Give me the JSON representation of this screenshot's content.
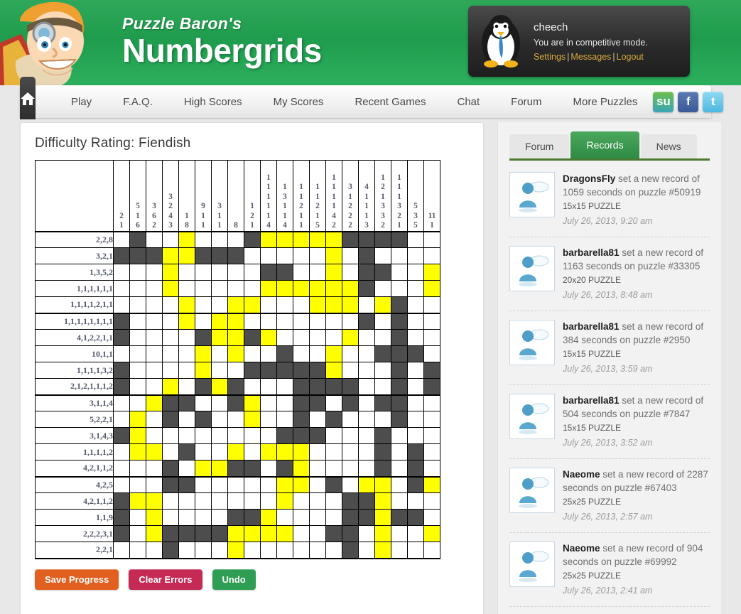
{
  "header": {
    "brand_top": "Puzzle Baron's",
    "brand_main": "Numbergrids",
    "user": {
      "name": "cheech",
      "mode": "You are in competitive mode.",
      "settings": "Settings",
      "messages": "Messages",
      "logout": "Logout",
      "sep": "|"
    }
  },
  "nav": {
    "home_icon": "home-icon",
    "items": [
      "Play",
      "F.A.Q.",
      "High Scores",
      "My Scores",
      "Recent Games",
      "Chat",
      "Forum",
      "More Puzzles"
    ],
    "socials": [
      {
        "name": "stumbleupon-icon",
        "glyph": "su",
        "color": "#6cbf4a"
      },
      {
        "name": "facebook-icon",
        "glyph": "f",
        "color": "#3b5998"
      },
      {
        "name": "twitter-icon",
        "glyph": "t",
        "color": "#4db8e0"
      }
    ]
  },
  "puzzle": {
    "difficulty_label": "Difficulty Rating: Fiendish",
    "size": 20,
    "colors": {
      "filled": "#4d4d4d",
      "marked": "#ffff00",
      "empty": "#ffffff",
      "clue_text": "#54596b"
    },
    "col_clues": [
      [
        "2",
        "1"
      ],
      [
        "5",
        "1",
        "6"
      ],
      [
        "3",
        "6",
        "2"
      ],
      [
        "3",
        "2",
        "4",
        "3"
      ],
      [
        "1",
        "8"
      ],
      [
        "9",
        "1",
        "1"
      ],
      [
        "3",
        "1",
        "1"
      ],
      [
        "8"
      ],
      [
        "1",
        "2",
        "1"
      ],
      [
        "1",
        "1",
        "1",
        "1",
        "1",
        "4"
      ],
      [
        "1",
        "3",
        "1",
        "1",
        "4"
      ],
      [
        "1",
        "1",
        "2",
        "1",
        "1"
      ],
      [
        "1",
        "1",
        "2",
        "1",
        "5"
      ],
      [
        "1",
        "1",
        "1",
        "1",
        "4",
        "2"
      ],
      [
        "3",
        "1",
        "2",
        "2",
        "2"
      ],
      [
        "4",
        "1",
        "1",
        "1",
        "3"
      ],
      [
        "1",
        "2",
        "1",
        "3",
        "3",
        "2"
      ],
      [
        "1",
        "1",
        "1",
        "3",
        "2",
        "1"
      ],
      [
        "5",
        "3",
        "5"
      ],
      [
        "11",
        "1"
      ]
    ],
    "row_clues": [
      "2,2,8",
      "3,2,1",
      "1,3,5,2",
      "1,1,1,1,1,1",
      "1,1,1,1,2,1,1",
      "1,1,1,1,1,1,1,1",
      "4,1,2,2,1,1",
      "10,1,1",
      "1,1,1,1,3,2",
      "2,1,2,1,1,1,2",
      "3,1,1,4",
      "5,2,2,1",
      "3,1,4,3",
      "1,1,1,1,2",
      "4,2,1,1,2",
      "4,2,5",
      "4,2,1,1,2",
      "1,1,9",
      "2,2,2,3,1",
      "2,2,1"
    ],
    "cells": [
      [
        "e",
        "f",
        "e",
        "e",
        "y",
        "e",
        "e",
        "e",
        "f",
        "y",
        "y",
        "y",
        "y",
        "y",
        "f",
        "f",
        "f",
        "f",
        "e",
        "e"
      ],
      [
        "f",
        "f",
        "f",
        "y",
        "y",
        "f",
        "f",
        "f",
        "e",
        "e",
        "e",
        "e",
        "e",
        "y",
        "e",
        "f",
        "e",
        "e",
        "e",
        "e"
      ],
      [
        "e",
        "e",
        "e",
        "y",
        "e",
        "e",
        "e",
        "e",
        "e",
        "f",
        "f",
        "e",
        "e",
        "y",
        "e",
        "f",
        "f",
        "e",
        "e",
        "y"
      ],
      [
        "e",
        "e",
        "e",
        "y",
        "e",
        "e",
        "e",
        "e",
        "e",
        "y",
        "y",
        "y",
        "y",
        "y",
        "y",
        "f",
        "e",
        "e",
        "e",
        "y"
      ],
      [
        "e",
        "e",
        "e",
        "e",
        "y",
        "e",
        "e",
        "y",
        "y",
        "e",
        "e",
        "e",
        "y",
        "y",
        "y",
        "e",
        "y",
        "f",
        "e",
        "e"
      ],
      [
        "f",
        "e",
        "e",
        "e",
        "y",
        "e",
        "y",
        "y",
        "e",
        "e",
        "e",
        "e",
        "e",
        "e",
        "e",
        "f",
        "e",
        "f",
        "e",
        "e"
      ],
      [
        "f",
        "e",
        "e",
        "e",
        "e",
        "f",
        "y",
        "y",
        "f",
        "y",
        "e",
        "e",
        "e",
        "e",
        "y",
        "e",
        "e",
        "f",
        "e",
        "e"
      ],
      [
        "e",
        "e",
        "e",
        "e",
        "e",
        "y",
        "e",
        "y",
        "e",
        "e",
        "f",
        "e",
        "e",
        "y",
        "e",
        "e",
        "f",
        "f",
        "f",
        "e"
      ],
      [
        "f",
        "e",
        "e",
        "e",
        "e",
        "y",
        "e",
        "e",
        "f",
        "f",
        "f",
        "f",
        "f",
        "y",
        "e",
        "e",
        "e",
        "f",
        "e",
        "f"
      ],
      [
        "f",
        "e",
        "e",
        "y",
        "e",
        "f",
        "y",
        "f",
        "e",
        "e",
        "e",
        "f",
        "f",
        "f",
        "f",
        "e",
        "e",
        "f",
        "e",
        "f"
      ],
      [
        "e",
        "e",
        "y",
        "f",
        "f",
        "e",
        "e",
        "f",
        "y",
        "e",
        "e",
        "f",
        "f",
        "e",
        "f",
        "e",
        "f",
        "f",
        "e",
        "e"
      ],
      [
        "e",
        "y",
        "e",
        "f",
        "e",
        "f",
        "e",
        "e",
        "y",
        "e",
        "e",
        "f",
        "e",
        "f",
        "e",
        "e",
        "e",
        "f",
        "e",
        "e"
      ],
      [
        "f",
        "y",
        "e",
        "e",
        "e",
        "e",
        "e",
        "e",
        "e",
        "e",
        "f",
        "f",
        "f",
        "e",
        "e",
        "e",
        "f",
        "e",
        "e",
        "e"
      ],
      [
        "e",
        "y",
        "y",
        "e",
        "f",
        "e",
        "e",
        "y",
        "e",
        "y",
        "y",
        "y",
        "e",
        "e",
        "e",
        "e",
        "f",
        "e",
        "f",
        "e"
      ],
      [
        "e",
        "e",
        "e",
        "f",
        "e",
        "y",
        "y",
        "f",
        "f",
        "e",
        "f",
        "y",
        "e",
        "e",
        "e",
        "e",
        "f",
        "e",
        "f",
        "e"
      ],
      [
        "e",
        "e",
        "e",
        "f",
        "f",
        "e",
        "e",
        "e",
        "e",
        "e",
        "y",
        "y",
        "e",
        "f",
        "e",
        "y",
        "y",
        "e",
        "f",
        "y"
      ],
      [
        "f",
        "y",
        "y",
        "e",
        "e",
        "e",
        "e",
        "e",
        "e",
        "e",
        "y",
        "e",
        "e",
        "e",
        "f",
        "f",
        "y",
        "e",
        "e",
        "e"
      ],
      [
        "f",
        "e",
        "y",
        "e",
        "e",
        "e",
        "e",
        "f",
        "f",
        "y",
        "e",
        "e",
        "e",
        "e",
        "f",
        "f",
        "y",
        "f",
        "f",
        "e"
      ],
      [
        "f",
        "e",
        "y",
        "f",
        "f",
        "f",
        "f",
        "y",
        "y",
        "y",
        "y",
        "e",
        "e",
        "f",
        "f",
        "e",
        "y",
        "e",
        "e",
        "y"
      ],
      [
        "e",
        "e",
        "e",
        "f",
        "e",
        "e",
        "e",
        "y",
        "e",
        "e",
        "e",
        "e",
        "e",
        "e",
        "f",
        "e",
        "y",
        "e",
        "e",
        "e"
      ]
    ],
    "buttons": [
      {
        "label": "Save Progress",
        "color": "#e2601f",
        "name": "save-progress-button"
      },
      {
        "label": "Clear Errors",
        "color": "#c42a54",
        "name": "clear-errors-button"
      },
      {
        "label": "Undo",
        "color": "#2f9e54",
        "name": "undo-button"
      }
    ]
  },
  "sidebar": {
    "tabs": [
      {
        "label": "Forum",
        "active": false
      },
      {
        "label": "Records",
        "active": true
      },
      {
        "label": "News",
        "active": false
      }
    ],
    "records": [
      {
        "user": "DragonsFly",
        "text": "set a new record of 1059 seconds on puzzle #50919",
        "size": "15x15 PUZZLE",
        "date": "July 26, 2013, 9:20 am"
      },
      {
        "user": "barbarella81",
        "text": "set a new record of 1163 seconds on puzzle #33305",
        "size": "20x20 PUZZLE",
        "date": "July 26, 2013, 8:48 am"
      },
      {
        "user": "barbarella81",
        "text": "set a new record of 384 seconds on puzzle #2950",
        "size": "15x15 PUZZLE",
        "date": "July 26, 2013, 3:59 am"
      },
      {
        "user": "barbarella81",
        "text": "set a new record of 504 seconds on puzzle #7847",
        "size": "15x15 PUZZLE",
        "date": "July 26, 2013, 3:52 am"
      },
      {
        "user": "Naeome",
        "text": "set a new record of 2287 seconds on puzzle #67403",
        "size": "25x25 PUZZLE",
        "date": "July 26, 2013, 2:57 am"
      },
      {
        "user": "Naeome",
        "text": "set a new record of 904 seconds on puzzle #69992",
        "size": "25x25 PUZZLE",
        "date": "July 26, 2013, 2:41 am"
      }
    ]
  }
}
